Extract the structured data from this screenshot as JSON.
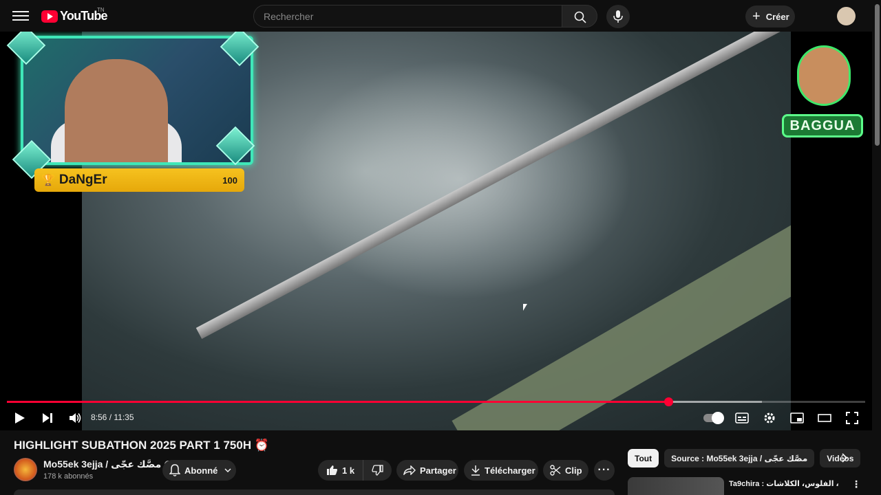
{
  "header": {
    "logo_text": "YouTube",
    "logo_country": "TN",
    "search_placeholder": "Rechercher",
    "create_label": "Créer"
  },
  "player": {
    "overlay_name": "DaNgEr",
    "overlay_score": "100",
    "overlay_brand": "BAGGUA",
    "current_time": "8:56",
    "duration": "11:35",
    "time_display": "8:56 / 11:35",
    "progress_fraction": 0.771,
    "buffer_fraction": 0.88
  },
  "video": {
    "title": "HIGHLIGHT SUBATHON 2025 PART 1 750H ⏰",
    "channel_name": "Mo55ek 3ejja / مصَّك عجّى",
    "subscribers": "178 k abonnés",
    "subscribe_label": "Abonné",
    "like_count": "1 k",
    "share_label": "Partager",
    "download_label": "Télécharger",
    "clip_label": "Clip",
    "more_label": "···"
  },
  "sidebar": {
    "chips": [
      "Tout",
      "Source : Mo55ek 3ejja / مصَّك عجّى",
      "Vidéos"
    ],
    "active_chip": 0,
    "reco_title": "Ta9chira : الراب، الفلوس، الكلاشات،"
  },
  "colors": {
    "accent": "#ff0033",
    "background": "#0f0f0f",
    "chip_bg": "#272727",
    "overlay_gold": "#f6c21f",
    "overlay_green": "#3fe7b8"
  }
}
